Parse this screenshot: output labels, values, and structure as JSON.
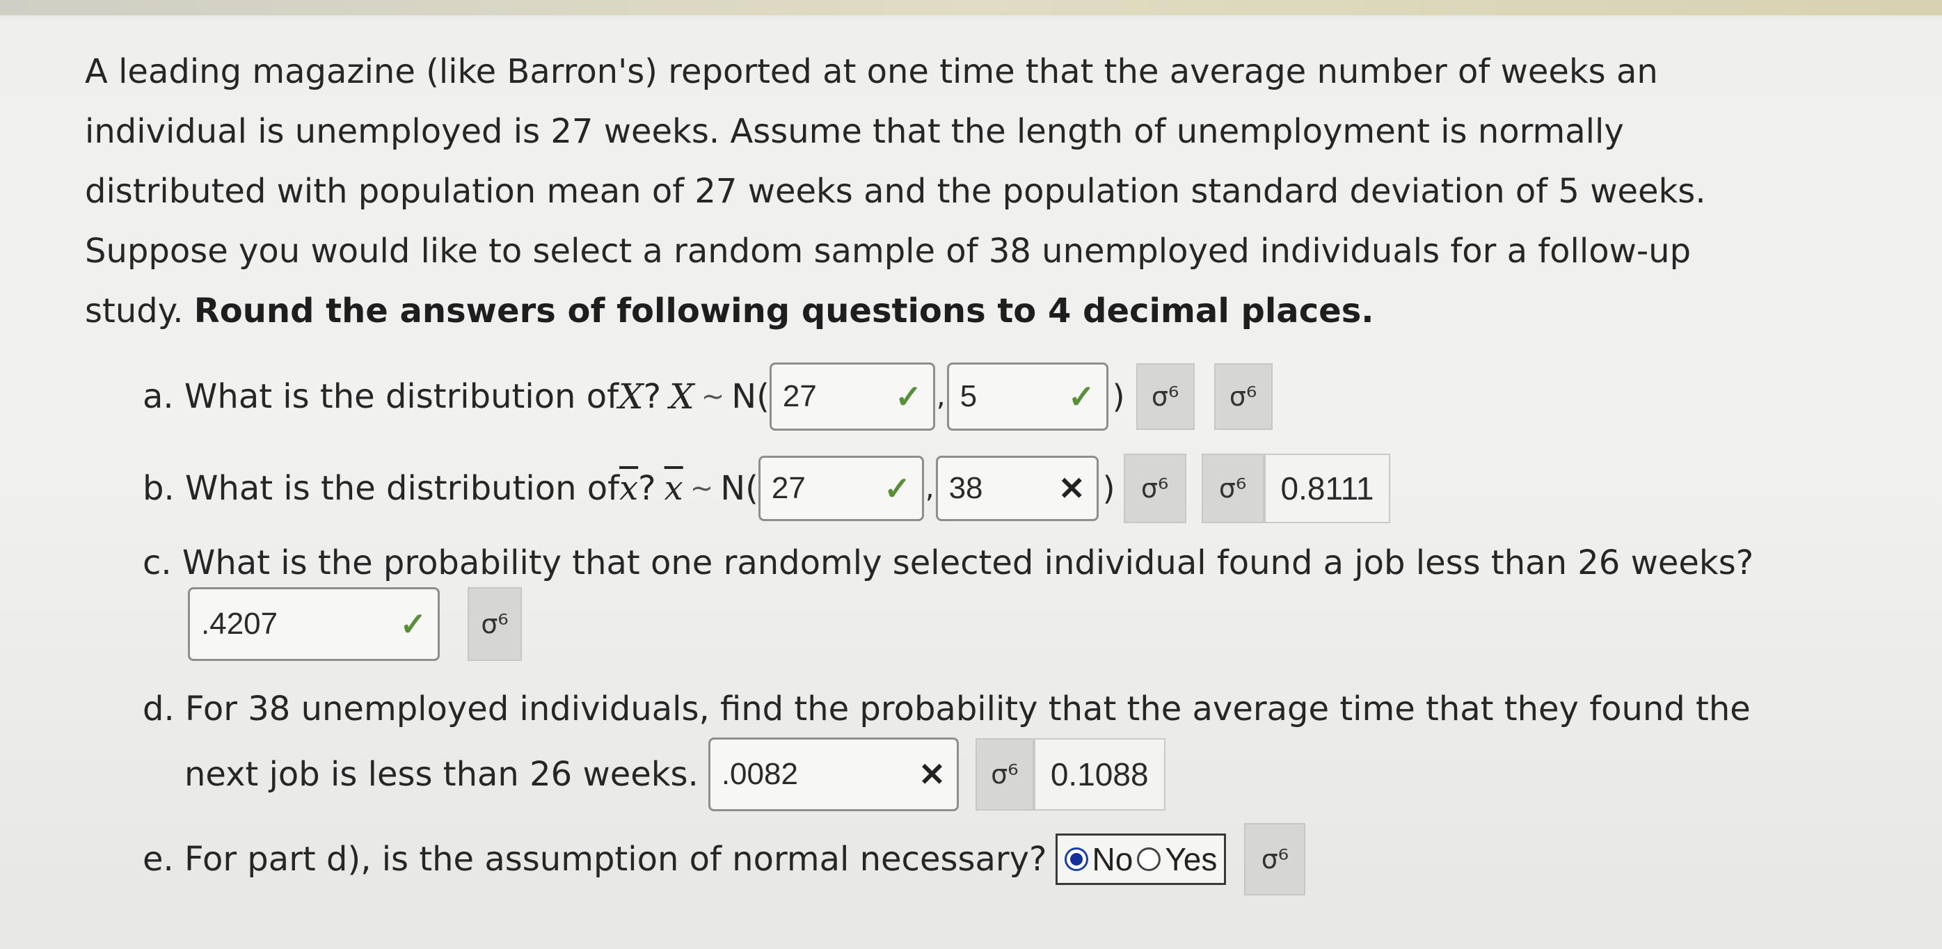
{
  "prompt": {
    "line1": "A leading magazine (like Barron's) reported at one time that the average number of weeks an",
    "line2": "individual is unemployed is 27 weeks. Assume that the length of unemployment is normally",
    "line3": "distributed with population mean of 27 weeks and the population standard deviation of 5 weeks.",
    "line4": "Suppose you would like to select a random sample of 38 unemployed individuals for a follow-up",
    "line5_start": "study. ",
    "line5_bold": "Round the answers of following questions to 4 decimal places."
  },
  "hint_icon": "σ⁶",
  "part_a": {
    "label": "a. What is the distribution of ",
    "var": "X",
    "q": "?",
    "var2": "X",
    "tilde": "~",
    "dist": "N(",
    "mean_value": "27",
    "sd_value": "5",
    "mean_status": "check-icon",
    "sd_status": "check-icon",
    "close": ")"
  },
  "part_b": {
    "label": "b. What is the distribution of ",
    "var": "x",
    "q": "?",
    "var2": "x",
    "tilde": "~",
    "dist": "N(",
    "mean_value": "27",
    "sd_value": "38",
    "mean_status": "check-icon",
    "sd_status": "x-icon",
    "close": ")",
    "correct_answer": "0.8111"
  },
  "part_c": {
    "question": "c. What is the probability that one randomly selected individual found a job less than 26 weeks?",
    "value": ".4207",
    "status": "check-icon"
  },
  "part_d": {
    "question_line1": "d. For 38 unemployed individuals, find the probability that the average time that they found the",
    "question_line2": "next job is less than 26 weeks.",
    "value": ".0082",
    "status": "x-icon",
    "correct_answer": "0.1088"
  },
  "part_e": {
    "question": "e. For part d), is the assumption of normal necessary?",
    "options": [
      "No",
      "Yes"
    ],
    "selected": "No"
  },
  "marks": {
    "check": "✓",
    "x": "✕"
  },
  "colors": {
    "check": "#5a8f3a",
    "radio_selected": "#14309a"
  }
}
